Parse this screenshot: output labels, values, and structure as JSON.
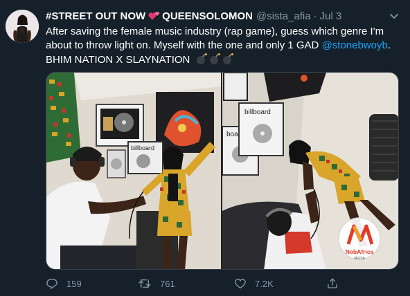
{
  "tweet": {
    "display_name": "#STREET OUT NOW",
    "display_name_suffix": "QUEENSOLOMON",
    "handle": "@sista_afia",
    "separator": "·",
    "date": "Jul 3",
    "text_line1": "After saving the female music industry (rap game), guess which genre I'm about to throw light on. Myself with the one and only 1 GAD ",
    "mention": "@stonebwoyb",
    "text_line1_end": ".",
    "text_line2": "BHIM NATION X SLAYNATION",
    "watermark_brand": "NobAfrica",
    "watermark_sub": "MEDIA"
  },
  "stats": {
    "replies": "159",
    "retweets": "761",
    "likes": "7.2K"
  },
  "icons": {
    "reply": "reply-icon",
    "retweet": "retweet-icon",
    "like": "heart-icon",
    "share": "share-icon",
    "caret": "chevron-down-icon",
    "heart_emoji": "two-hearts-emoji-icon",
    "bomb_emoji": "bomb-emoji-icon"
  },
  "colors": {
    "background": "#15202b",
    "text_primary": "#ffffff",
    "text_secondary": "#8899a6",
    "link": "#1da1f2",
    "heart_emoji": "#e2376e"
  }
}
